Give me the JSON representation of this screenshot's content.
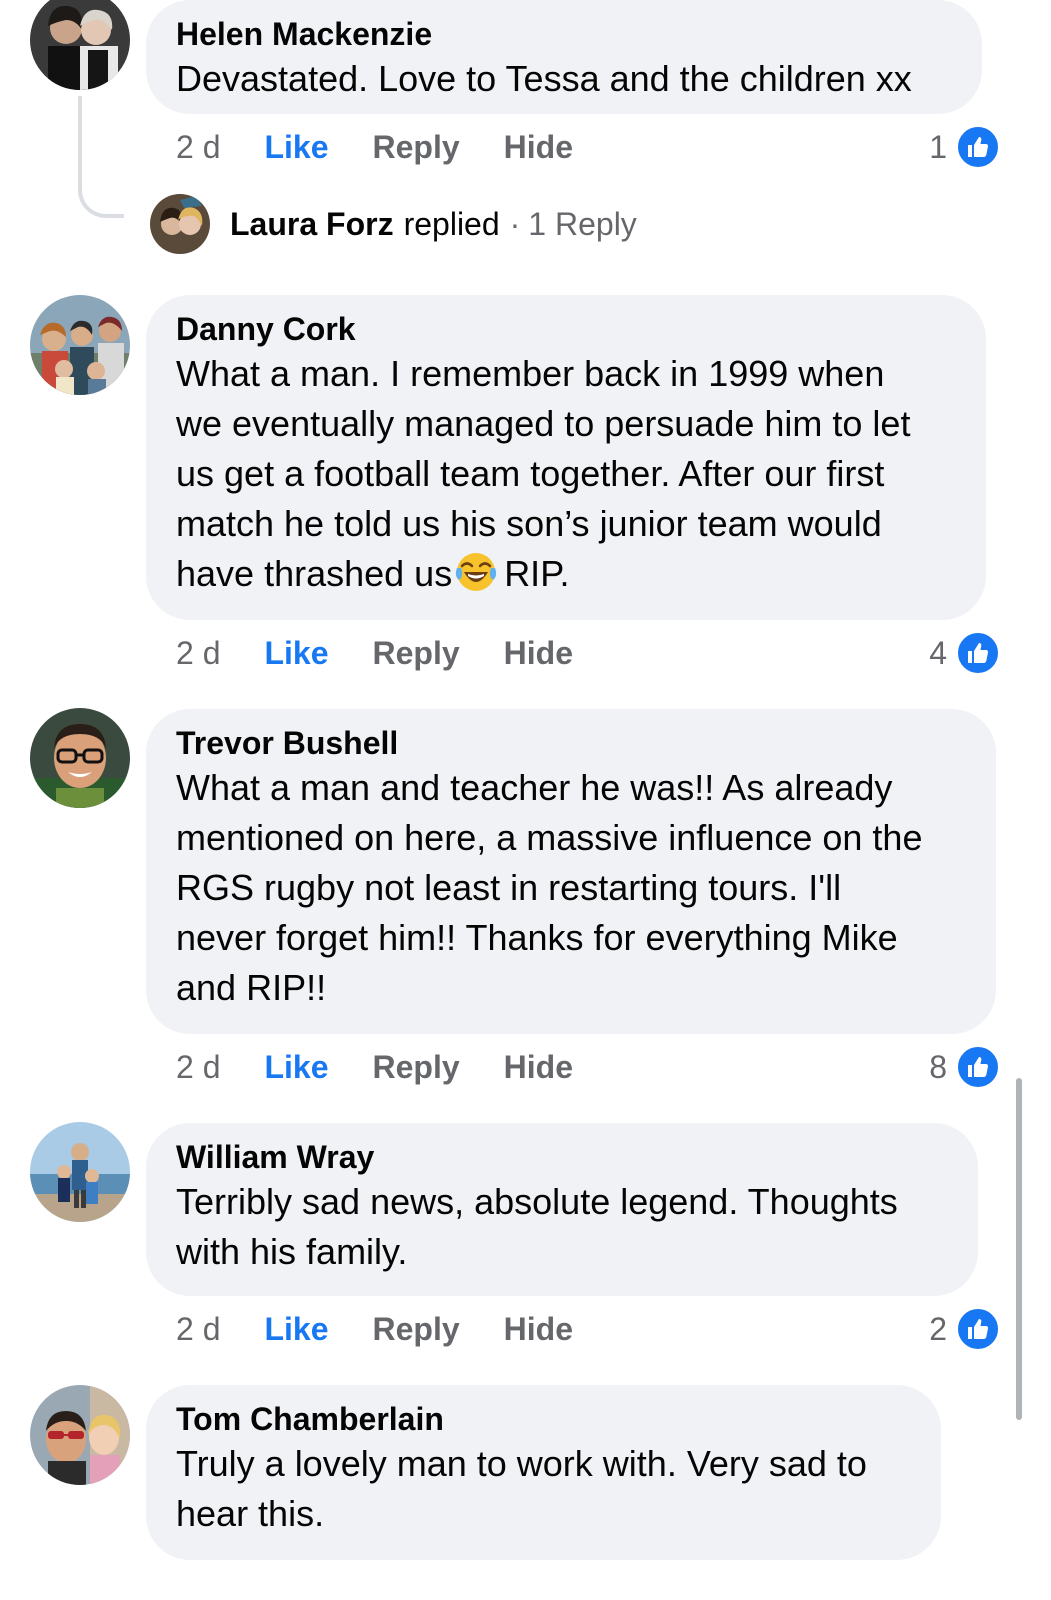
{
  "comments": [
    {
      "author": "Helen Mackenzie",
      "text": "Devastated. Love to Tessa and the children xx",
      "time": "2 d",
      "like": "Like",
      "reply": "Reply",
      "hide": "Hide",
      "reactions": "1",
      "replies": {
        "name": "Laura Forz",
        "verb": "replied",
        "separator": "·",
        "count": "1 Reply"
      }
    },
    {
      "author": "Danny Cork",
      "text_before_emoji": "What a man. I remember back in 1999 when\nwe eventually managed to persuade him to let\nus get a football team together. After our first\nmatch he told us his son’s junior team would\nhave thrashed us",
      "text_after_emoji": "RIP.",
      "emoji": "face-with-tears-of-joy-emoji",
      "time": "2 d",
      "like": "Like",
      "reply": "Reply",
      "hide": "Hide",
      "reactions": "4"
    },
    {
      "author": "Trevor Bushell",
      "text": "What a man and teacher he was!! As already\nmentioned on here, a massive influence on the\nRGS rugby not least in restarting tours. I'll\nnever forget him!! Thanks for everything Mike\nand RIP!!",
      "time": "2 d",
      "like": "Like",
      "reply": "Reply",
      "hide": "Hide",
      "reactions": "8"
    },
    {
      "author": "William Wray",
      "text": "Terribly sad news, absolute legend. Thoughts\nwith his family.",
      "time": "2 d",
      "like": "Like",
      "reply": "Reply",
      "hide": "Hide",
      "reactions": "2"
    },
    {
      "author": "Tom Chamberlain",
      "text": "Truly a lovely man to work with. Very sad to\nhear this."
    }
  ],
  "colors": {
    "bubble": "#f0f2f5",
    "like_blue": "#1877f2",
    "meta_gray": "#65676b",
    "text": "#050505"
  },
  "icons": {
    "reaction": "like-thumbs-up-icon",
    "emoji": "face-with-tears-of-joy-emoji"
  }
}
